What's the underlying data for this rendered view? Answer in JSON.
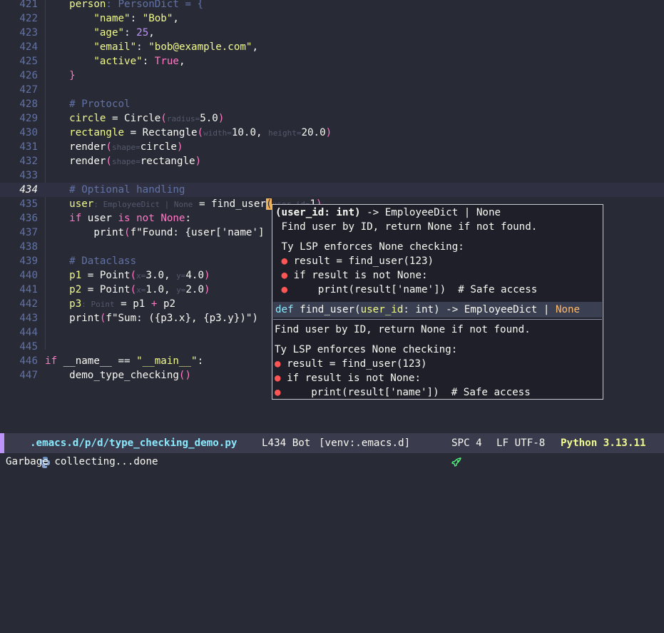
{
  "editor": {
    "lines": [
      {
        "n": "421",
        "segs": [
          [
            "    ",
            ""
          ],
          [
            "person",
            "var"
          ],
          [
            ": PersonDict = {",
            "cmt"
          ]
        ]
      },
      {
        "n": "422",
        "segs": [
          [
            "        ",
            ""
          ],
          [
            "\"name\"",
            "str"
          ],
          [
            ": ",
            ""
          ],
          [
            "\"Bob\"",
            "str"
          ],
          [
            ",",
            ""
          ]
        ]
      },
      {
        "n": "423",
        "segs": [
          [
            "        ",
            ""
          ],
          [
            "\"age\"",
            "str"
          ],
          [
            ": ",
            ""
          ],
          [
            "25",
            "num"
          ],
          [
            ",",
            ""
          ]
        ]
      },
      {
        "n": "424",
        "segs": [
          [
            "        ",
            ""
          ],
          [
            "\"email\"",
            "str"
          ],
          [
            ": ",
            ""
          ],
          [
            "\"bob@example.com\"",
            "str"
          ],
          [
            ",",
            ""
          ]
        ]
      },
      {
        "n": "425",
        "segs": [
          [
            "        ",
            ""
          ],
          [
            "\"active\"",
            "str"
          ],
          [
            ": ",
            ""
          ],
          [
            "True",
            "con"
          ],
          [
            ",",
            ""
          ]
        ]
      },
      {
        "n": "426",
        "segs": [
          [
            "    ",
            ""
          ],
          [
            "}",
            "paren"
          ]
        ]
      },
      {
        "n": "427",
        "segs": [
          [
            "",
            ""
          ]
        ]
      },
      {
        "n": "428",
        "segs": [
          [
            "    ",
            ""
          ],
          [
            "# Protocol",
            "cmt"
          ]
        ]
      },
      {
        "n": "429",
        "segs": [
          [
            "    ",
            ""
          ],
          [
            "circle",
            "var"
          ],
          [
            " = Circle",
            ""
          ],
          [
            "(",
            "paren"
          ],
          [
            "radius=",
            "hint"
          ],
          [
            "5.0",
            ""
          ],
          [
            ")",
            "paren"
          ]
        ]
      },
      {
        "n": "430",
        "segs": [
          [
            "    ",
            ""
          ],
          [
            "rectangle",
            "var"
          ],
          [
            " = Rectangle",
            ""
          ],
          [
            "(",
            "paren"
          ],
          [
            "width=",
            "hint"
          ],
          [
            "10.0, ",
            ""
          ],
          [
            "height=",
            "hint"
          ],
          [
            "20.0",
            ""
          ],
          [
            ")",
            "paren"
          ]
        ]
      },
      {
        "n": "431",
        "segs": [
          [
            "    render",
            ""
          ],
          [
            "(",
            "paren"
          ],
          [
            "shape=",
            "hint"
          ],
          [
            "circle",
            ""
          ],
          [
            ")",
            "paren"
          ]
        ]
      },
      {
        "n": "432",
        "segs": [
          [
            "    render",
            ""
          ],
          [
            "(",
            "paren"
          ],
          [
            "shape=",
            "hint"
          ],
          [
            "rectangle",
            ""
          ],
          [
            ")",
            "paren"
          ]
        ]
      },
      {
        "n": "433",
        "segs": [
          [
            "",
            ""
          ]
        ]
      },
      {
        "n": "434",
        "segs": [
          [
            "    ",
            ""
          ],
          [
            "# Optional handling",
            "cmt"
          ]
        ]
      },
      {
        "n": "435",
        "segs": [
          [
            "    ",
            ""
          ],
          [
            "user",
            "var"
          ],
          [
            ": EmployeeDict | None",
            "hint"
          ],
          [
            " = find_user",
            ""
          ],
          [
            "(",
            "cursor"
          ],
          [
            "user_id=",
            "hint"
          ],
          [
            "1",
            ""
          ],
          [
            ")",
            "paren"
          ]
        ]
      },
      {
        "n": "436",
        "segs": [
          [
            "    ",
            ""
          ],
          [
            "if",
            "kw"
          ],
          [
            " user ",
            ""
          ],
          [
            "is not",
            "kw"
          ],
          [
            " ",
            ""
          ],
          [
            "None",
            "con"
          ],
          [
            ":",
            ""
          ]
        ]
      },
      {
        "n": "437",
        "segs": [
          [
            "        print",
            ""
          ],
          [
            "(",
            "paren"
          ],
          [
            "f\"Found: {user['name']",
            ""
          ]
        ]
      },
      {
        "n": "438",
        "segs": [
          [
            "",
            ""
          ]
        ]
      },
      {
        "n": "439",
        "segs": [
          [
            "    ",
            ""
          ],
          [
            "# Dataclass",
            "cmt"
          ]
        ]
      },
      {
        "n": "440",
        "segs": [
          [
            "    ",
            ""
          ],
          [
            "p1",
            "var"
          ],
          [
            " = Point",
            ""
          ],
          [
            "(",
            "paren"
          ],
          [
            "x=",
            "hint"
          ],
          [
            "3.0, ",
            ""
          ],
          [
            "y=",
            "hint"
          ],
          [
            "4.0",
            ""
          ],
          [
            ")",
            "paren"
          ]
        ]
      },
      {
        "n": "441",
        "segs": [
          [
            "    ",
            ""
          ],
          [
            "p2",
            "var"
          ],
          [
            " = Point",
            ""
          ],
          [
            "(",
            "paren"
          ],
          [
            "x=",
            "hint"
          ],
          [
            "1.0, ",
            ""
          ],
          [
            "y=",
            "hint"
          ],
          [
            "2.0",
            ""
          ],
          [
            ")",
            "paren"
          ]
        ]
      },
      {
        "n": "442",
        "segs": [
          [
            "    ",
            ""
          ],
          [
            "p3",
            "var"
          ],
          [
            ": Point",
            "hint"
          ],
          [
            " = p1 ",
            ""
          ],
          [
            "+",
            "kw"
          ],
          [
            " p2",
            ""
          ]
        ]
      },
      {
        "n": "443",
        "segs": [
          [
            "    print",
            ""
          ],
          [
            "(",
            "paren"
          ],
          [
            "f\"Sum: ({p3.x}, {p3.y})\")",
            ""
          ]
        ]
      },
      {
        "n": "444",
        "segs": [
          [
            "",
            ""
          ]
        ]
      },
      {
        "n": "445",
        "segs": [
          [
            "",
            ""
          ]
        ]
      },
      {
        "n": "446",
        "segs": [
          [
            "",
            ""
          ],
          [
            "if",
            "kw"
          ],
          [
            " __name__ == ",
            ""
          ],
          [
            "\"__main__\"",
            "str"
          ],
          [
            ":",
            ""
          ]
        ]
      },
      {
        "n": "447",
        "segs": [
          [
            "    demo_type_checking",
            ""
          ],
          [
            "()",
            "paren"
          ]
        ]
      }
    ],
    "current_line": "434"
  },
  "popup": {
    "signature_param": "(user_id: int)",
    "signature_rest": " -> EmployeeDict | None",
    "doc_lines": [
      " Find user by ID, return None if not found.",
      "",
      " Ty LSP enforces None checking:"
    ],
    "bullets_top": [
      "result = find_user(123)",
      "if result is not None:",
      "    print(result['name'])  # Safe access"
    ],
    "completion_def": "def",
    "completion_name": " find_user(",
    "completion_param": "user_id",
    "completion_type": ": int) -> EmployeeDict | ",
    "completion_none": "None",
    "doc2": [
      "Find user by ID, return None if not found.",
      "",
      "Ty LSP enforces None checking:"
    ],
    "bullets_bottom": [
      "result = find_user(123)",
      "if result is not None:",
      "    print(result['name'])  # Safe access"
    ],
    "bullet_glyph": "●"
  },
  "modeline": {
    "path": ".emacs.d/p/d/type_checking_demo.py",
    "position": "L434 Bot",
    "venv": "[venv:.emacs.d]",
    "indent": "SPC 4",
    "encoding": "LF UTF-8",
    "python": "Python 3.13.11",
    "colors": {
      "bar": "#bd93f9",
      "python": "#f1fa8c",
      "rocket": "#50fa7b"
    }
  },
  "echo": "Garbage collecting...done"
}
